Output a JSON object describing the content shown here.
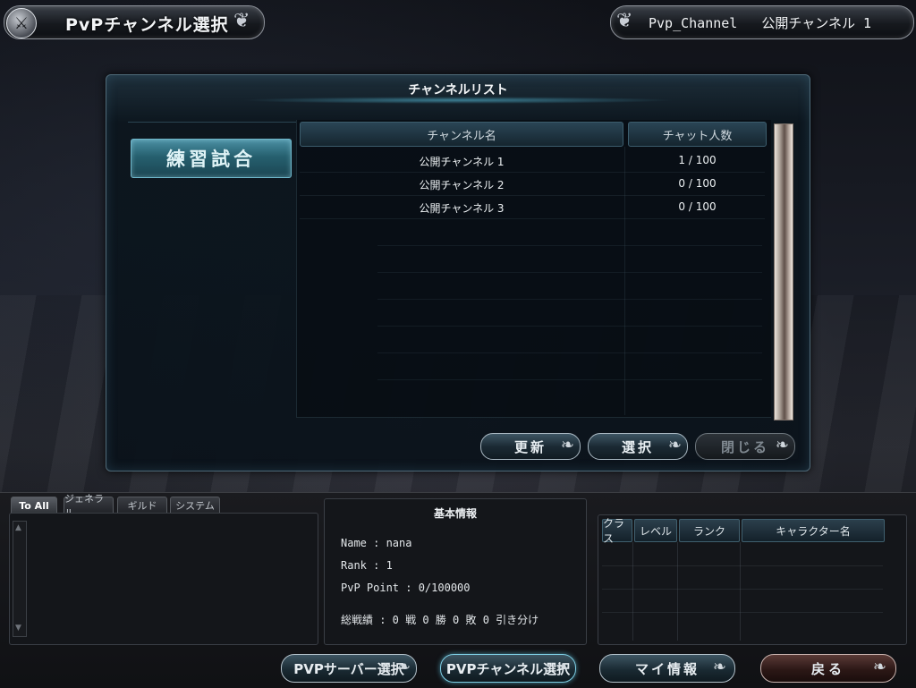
{
  "header": {
    "title": "PvPチャンネル選択",
    "channel_info": "Pvp_Channel   公開チャンネル 1"
  },
  "channel_panel": {
    "title": "チャンネルリスト",
    "category": "練習試合",
    "columns": {
      "name": "チャンネル名",
      "count": "チャット人数"
    },
    "rows": [
      {
        "name": "公開チャンネル 1",
        "count": "1 / 100"
      },
      {
        "name": "公開チャンネル 2",
        "count": "0 / 100"
      },
      {
        "name": "公開チャンネル 3",
        "count": "0 / 100"
      }
    ],
    "buttons": {
      "refresh": "更新",
      "select": "選択",
      "close": "閉じる"
    }
  },
  "chat": {
    "tabs": [
      "To All",
      "ジェネラル",
      "ギルド",
      "システム"
    ]
  },
  "info": {
    "title": "基本情報",
    "name": "Name : nana",
    "rank": "Rank : 1",
    "pvp_point": "PvP Point : 0/100000",
    "record": "総戦績 : 0 戦 0 勝 0 敗 0 引き分け"
  },
  "members": {
    "columns": {
      "class": "クラス",
      "level": "レベル",
      "rank": "ランク",
      "name": "キャラクター名"
    }
  },
  "nav": {
    "server": "PVPサーバー選択",
    "channel": "PVPチャンネル選択",
    "myinfo": "マイ情報",
    "back": "戻る"
  },
  "icons": {
    "emblem": "crossed-swords-icon",
    "button_tail": "swirl-icon",
    "scroll_up": "arrow-up-icon",
    "scroll_down": "arrow-down-icon"
  },
  "colors": {
    "accent": "#6fb8cc",
    "panel": "#0f1a22",
    "back_button": "#5a3a36"
  }
}
